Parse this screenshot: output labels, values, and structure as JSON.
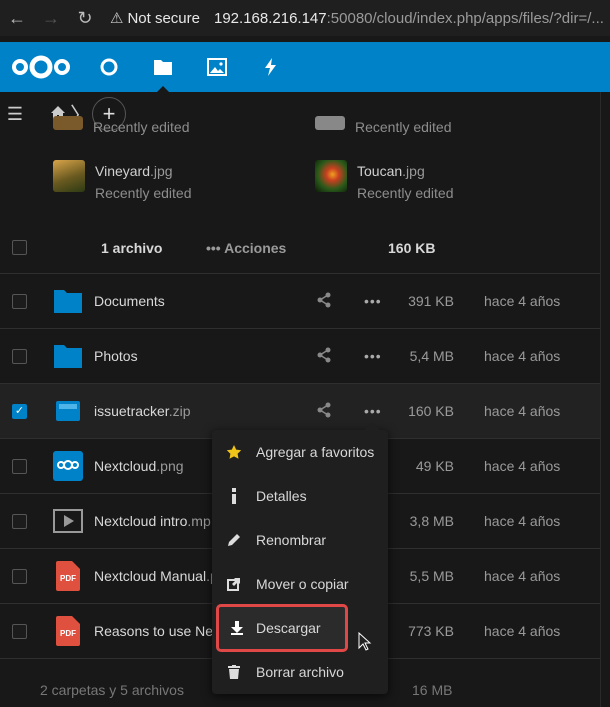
{
  "browser": {
    "warning_label": "Not secure",
    "url_host": "192.168.216.147",
    "url_path": ":50080/cloud/index.php/apps/files/?dir=/..."
  },
  "appbar": {
    "color": "#0082c9",
    "apps": [
      "dashboard-icon",
      "files-icon",
      "photos-icon",
      "activity-icon"
    ]
  },
  "recent": [
    {
      "base": "",
      "ext": "",
      "sub": "Recently edited"
    },
    {
      "base": "",
      "ext": "",
      "sub": "Recently edited"
    },
    {
      "base": "Vineyard",
      "ext": ".jpg",
      "sub": "Recently edited"
    },
    {
      "base": "Toucan",
      "ext": ".jpg",
      "sub": "Recently edited"
    }
  ],
  "header": {
    "count": "1 archivo",
    "actions": "Acciones",
    "total": "160 KB"
  },
  "files": [
    {
      "base": "Documents",
      "ext": "",
      "size": "391 KB",
      "date": "hace 4 años",
      "icon": "folder-icon",
      "selected": false
    },
    {
      "base": "Photos",
      "ext": "",
      "size": "5,4 MB",
      "date": "hace 4 años",
      "icon": "folder-icon",
      "selected": false
    },
    {
      "base": "issuetracker",
      "ext": ".zip",
      "size": "160 KB",
      "date": "hace 4 años",
      "icon": "archive-icon",
      "selected": true
    },
    {
      "base": "Nextcloud",
      "ext": ".png",
      "size": "49 KB",
      "date": "hace 4 años",
      "icon": "image-icon",
      "selected": false
    },
    {
      "base": "Nextcloud intro",
      "ext": ".mp",
      "size": "3,8 MB",
      "date": "hace 4 años",
      "icon": "video-icon",
      "selected": false
    },
    {
      "base": "Nextcloud Manual",
      "ext": ".p",
      "size": "5,5 MB",
      "date": "hace 4 años",
      "icon": "pdf-icon",
      "selected": false
    },
    {
      "base": "Reasons to use Nex",
      "ext": "",
      "size": "773 KB",
      "date": "hace 4 años",
      "icon": "pdf-icon",
      "selected": false
    }
  ],
  "footer": {
    "summary": "2 carpetas y 5 archivos",
    "total": "16 MB"
  },
  "menu": [
    {
      "label": "Agregar a favoritos",
      "icon": "star-icon"
    },
    {
      "label": "Detalles",
      "icon": "info-icon"
    },
    {
      "label": "Renombrar",
      "icon": "pencil-icon"
    },
    {
      "label": "Mover o copiar",
      "icon": "external-icon"
    },
    {
      "label": "Descargar",
      "icon": "download-icon"
    },
    {
      "label": "Borrar archivo",
      "icon": "trash-icon"
    }
  ],
  "pdf_badge": "PDF"
}
